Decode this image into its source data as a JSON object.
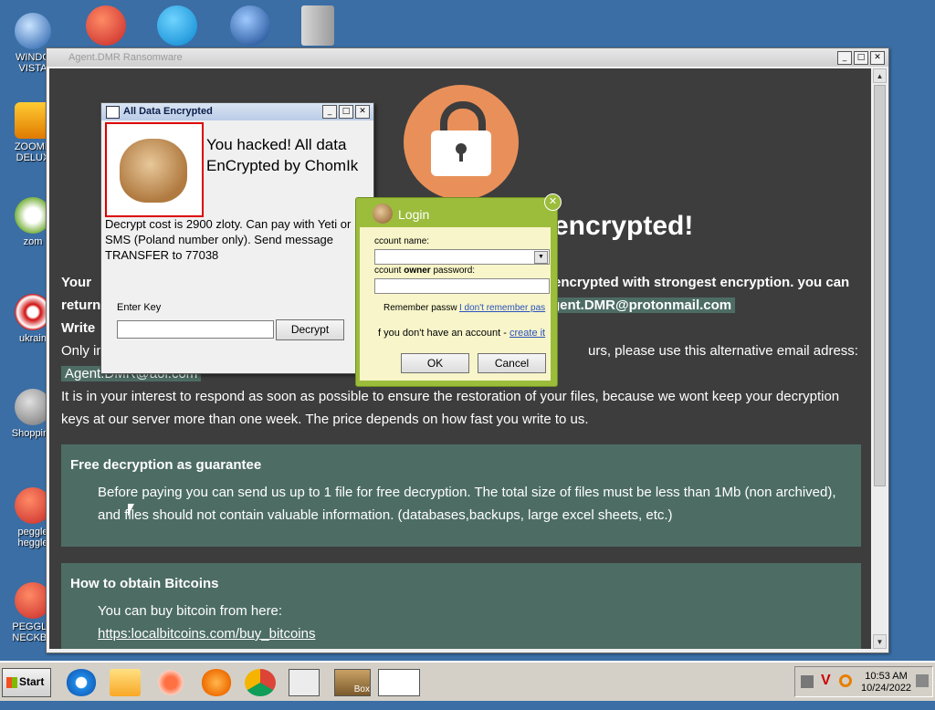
{
  "desktop": {
    "icons": [
      {
        "label": "WINDO\nVISTA",
        "icon": "windows-vista-icon"
      },
      {
        "label": "ZOOME\nDELUX",
        "icon": "zoom-icon"
      },
      {
        "label": "zom",
        "icon": "flower-icon"
      },
      {
        "label": "ukrain",
        "icon": "radiation-icon"
      },
      {
        "label": "Shopping",
        "icon": "flash-icon"
      },
      {
        "label": "peggle\nheggle",
        "icon": "peggle-icon"
      },
      {
        "label": "PEGGLE\nNECKBE",
        "icon": "peggle-icon"
      }
    ],
    "top_icons": [
      "peggle-icon",
      "skype-icon",
      "globe-icon",
      "folder-icon"
    ]
  },
  "main_window": {
    "title": "Agent.DMR Ransomware",
    "headline": "encrypted!",
    "para_your": "Your",
    "para_your_tail": "encrypted with strongest encryption. you can",
    "para_return": "return",
    "email_main": "gent.DMR@protonmail.com",
    "para_write": "Write",
    "para_only": "Only in",
    "para_only_tail": "urs, please use this alternative email adress:",
    "email_alt": "Agent.DMR@aol.com",
    "interest_line1": "It is in your interest to respond as soon as possible to ensure the restoration of your files, because we wont keep your decryption",
    "interest_line2": "keys at our server more than one week. The price depends on how fast you write to us.",
    "panel1": {
      "title": "Free decryption as guarantee",
      "line1": "Before paying you can send us up to 1 file for free decryption. The total size of files must be less than 1Mb (non archived),",
      "line2": "and files should not contain valuable information. (databases,backups, large excel sheets, etc.)"
    },
    "panel2": {
      "title": "How to obtain Bitcoins",
      "line1": "You can buy bitcoin from here:",
      "link": "https:localbitcoins.com/buy_bitcoins"
    }
  },
  "chomik_dialog": {
    "title": "All Data Encrypted",
    "message": "You hacked! All data EnCrypted by ChomIk",
    "cost": "Decrypt cost is 2900 zloty. Can pay with Yeti or SMS (Poland number only). Send message TRANSFER to 77038",
    "key_label": "Enter Key",
    "key_value": "",
    "decrypt_label": "Decrypt"
  },
  "login_dialog": {
    "title": "Login",
    "account_name_label": "ccount name:",
    "password_label_pre": "ccount ",
    "password_label_bold": "owner",
    "password_label_post": " password:",
    "remember_label": "Remember passw",
    "forgot_link": "I don't remember pas",
    "no_account_text": "f you don't have an account - ",
    "create_link": "create it",
    "ok_label": "OK",
    "cancel_label": "Cancel"
  },
  "taskbar": {
    "start_label": "Start",
    "box_label": "Box",
    "pinned": [
      "ie-icon",
      "explorer-icon",
      "media-player-icon",
      "uc-browser-icon",
      "chrome-icon",
      "window-icon",
      "box-icon",
      "ransom-app-icon"
    ],
    "tray_icons": [
      "network-icon",
      "antivirus-icon",
      "search-icon"
    ],
    "time": "10:53 AM",
    "date": "10/24/2022"
  }
}
